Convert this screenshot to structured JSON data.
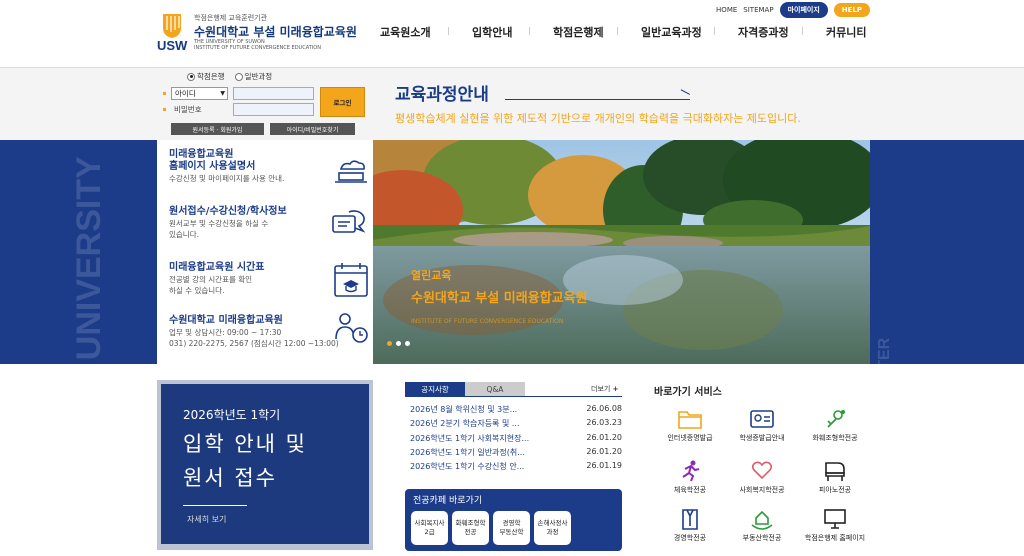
{
  "header": {
    "logo_sub": "학점은행제 교육훈련기관",
    "logo_title": "수원대학교 부설 미래융합교육원",
    "logo_en1": "THE UNIVERSITY OF SUWON",
    "logo_en2": "INSTITUTE OF FUTURE CONVERGENCE EDUCATION",
    "logo_usw": "USW",
    "util": {
      "home": "HOME",
      "sitemap": "SITEMAP",
      "mypage": "마이페이지",
      "help": "HELP"
    },
    "nav": [
      "교육원소개",
      "입학안내",
      "학점은행제",
      "일반교육과정",
      "자격증과정",
      "커뮤니티"
    ]
  },
  "login": {
    "radio_credit": "학점은행",
    "radio_general": "일반과정",
    "id_select": "아이디",
    "pw_label": "비밀번호",
    "login_button": "로그인",
    "register_button": "원서등록 · 회원가입",
    "find_button": "아이디/비밀번호찾기"
  },
  "intro": {
    "title": "교육과정안내",
    "text": "평생학습체계 실현을 위한 제도적 기반으로 개개인의 학습력을 극대화하자는 제도입니다."
  },
  "deco": {
    "left": "SUWON UNIVERSITY",
    "right": "EDUCATION CENTER"
  },
  "quick_links": [
    {
      "title1": "미래융합교육원",
      "title2": "홈페이지 사용설명서",
      "desc1": "수강신청 및 마이페이지를 사용 안내.",
      "desc2": "",
      "icon": "cloud-laptop-icon"
    },
    {
      "title1": "원서접수/수강신청/학사정보",
      "title2": "",
      "desc1": "원서교부 및 수강신청을 하실 수",
      "desc2": "있습니다.",
      "icon": "chat-bubbles-icon"
    },
    {
      "title1": "미래융합교육원 시간표",
      "title2": "",
      "desc1": "전공별 강의 시간표를 확인",
      "desc2": "하실 수 있습니다.",
      "icon": "calendar-icon"
    },
    {
      "title1": "수원대학교 미래융합교육원",
      "title2": "",
      "desc1": "업무 및 상담시간: 09:00 ~ 17:30",
      "desc2": "031) 220-2275, 2567 (점심시간 12:00 ~13:00)",
      "icon": "person-clock-icon"
    }
  ],
  "slide": {
    "cap1": "열린교육",
    "cap2": "수원대학교 부설 미래융합교육원",
    "cap3": "INSTITUTE OF FUTURE CONVERGENCE EDUCATION",
    "active_dot": 1
  },
  "banner": {
    "year": "2026학년도 1학기",
    "title1": "입학 안내 및",
    "title2": "원서 접수",
    "more": "자세히 보기"
  },
  "notices": {
    "tabs": [
      "공지사항",
      "Q&A"
    ],
    "more": "더보기",
    "items": [
      {
        "title": "2026년 8월 학위신청 및 3분...",
        "date": "26.06.08"
      },
      {
        "title": "2026년 2분기 학습자등록 및 ...",
        "date": "26.03.23"
      },
      {
        "title": "2026학년도 1학기 사회복지현장...",
        "date": "26.01.20"
      },
      {
        "title": "2026학년도 1학기 일반과정(취...",
        "date": "26.01.20"
      },
      {
        "title": "2026학년도 1학기 수강신청 안...",
        "date": "26.01.19"
      }
    ]
  },
  "majors": {
    "title": "전공카페 바로가기",
    "items": [
      {
        "l1": "사회복지사",
        "l2": "2급"
      },
      {
        "l1": "화훼조형학",
        "l2": "전공"
      },
      {
        "l1": "경영학",
        "l2": "부동산학"
      },
      {
        "l1": "손해사정사",
        "l2": "과정"
      }
    ]
  },
  "services": {
    "title": "바로가기 서비스",
    "items": [
      {
        "label": "인터넷증명발급",
        "icon": "folder-icon"
      },
      {
        "label": "학생증발급안내",
        "icon": "id-card-icon"
      },
      {
        "label": "화훼조형학전공",
        "icon": "flower-icon"
      },
      {
        "label": "체육학전공",
        "icon": "running-icon"
      },
      {
        "label": "사회복지학전공",
        "icon": "heart-hands-icon"
      },
      {
        "label": "피아노전공",
        "icon": "piano-icon"
      },
      {
        "label": "경영학전공",
        "icon": "suit-icon"
      },
      {
        "label": "부동산학전공",
        "icon": "house-hand-icon"
      },
      {
        "label": "학점은행제 홈페이지",
        "icon": "monitor-icon"
      }
    ]
  },
  "colors": {
    "navy": "#1c3c8a",
    "orange": "#f3a51b"
  }
}
